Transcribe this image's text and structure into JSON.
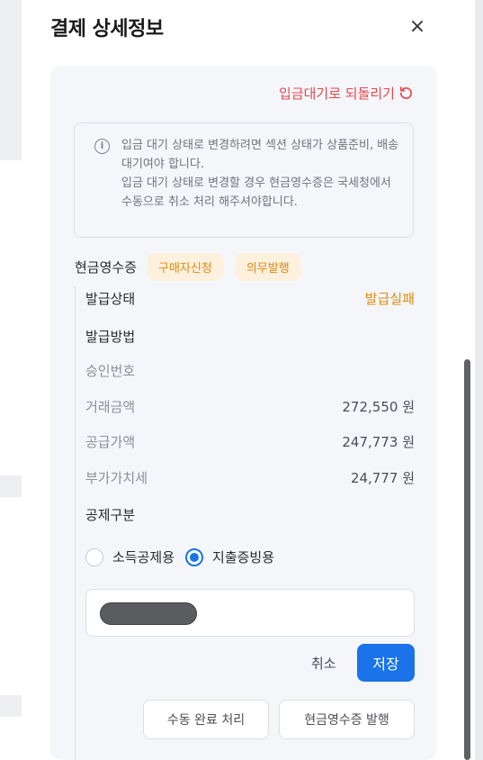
{
  "panel": {
    "title": "결제 상세정보",
    "close_label": "×"
  },
  "revert": {
    "label": "입금대기로 되돌리기",
    "icon": "refresh-icon",
    "color": "#e5484d"
  },
  "notice": {
    "icon": "info-icon",
    "lines": [
      "입금 대기 상태로 변경하려면 섹션 상태가 상품준비, 배송대기여야 합니다.",
      "입금 대기 상태로 변경할 경우 현금영수증은 국세청에서 수동으로 취소 처리 해주셔야합니다."
    ]
  },
  "receipt": {
    "label": "현금영수증",
    "tags": [
      "구매자신청",
      "의무발행"
    ]
  },
  "details": [
    {
      "label": "발급상태",
      "value": "발급실패"
    },
    {
      "label": "발급방법",
      "value": ""
    },
    {
      "label": "승인번호",
      "value": ""
    },
    {
      "label": "거래금액",
      "value": "272,550 원"
    },
    {
      "label": "공급가액",
      "value": "247,773 원"
    },
    {
      "label": "부가가치세",
      "value": "24,777 원"
    },
    {
      "label": "공제구분",
      "value": ""
    }
  ],
  "deduction": {
    "options": [
      "소득공제용",
      "지출증빙용"
    ],
    "selected_index": 1
  },
  "actions": {
    "cancel": "취소",
    "save": "저장",
    "manual_complete": "수동 완료 처리",
    "issue_receipt": "현금영수증 발행"
  },
  "colors": {
    "accent": "#1a73e8",
    "warning": "#e08a14",
    "danger": "#e5484d"
  }
}
